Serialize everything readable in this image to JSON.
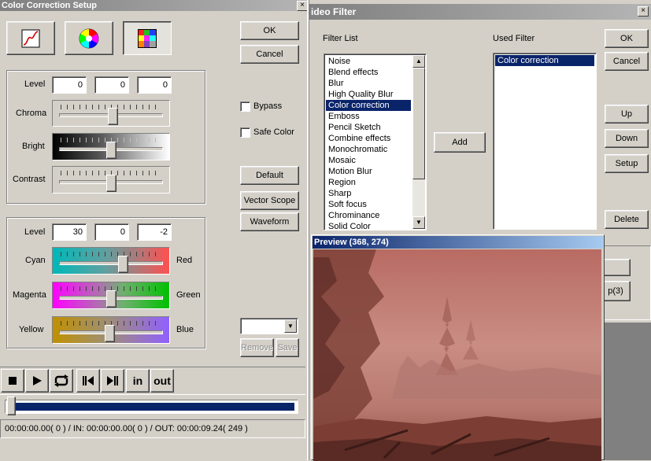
{
  "ccs": {
    "title": "Color Correction Setup",
    "close_glyph": "×",
    "ok_label": "OK",
    "cancel_label": "Cancel",
    "tool_icons": [
      "curve-icon",
      "color-wheel-icon",
      "color-grid-icon"
    ],
    "group1": {
      "level_label": "Level",
      "level_values": [
        "0",
        "0",
        "0"
      ],
      "chroma_label": "Chroma",
      "bright_label": "Bright",
      "contrast_label": "Contrast"
    },
    "bypass_label": "Bypass",
    "safe_color_label": "Safe Color",
    "default_label": "Default",
    "vector_scope_label": "Vector Scope",
    "waveform_label": "Waveform",
    "group2": {
      "level_label": "Level",
      "level_values": [
        "30",
        "0",
        "-2"
      ],
      "rows": [
        {
          "left": "Cyan",
          "right": "Red"
        },
        {
          "left": "Magenta",
          "right": "Green"
        },
        {
          "left": "Yellow",
          "right": "Blue"
        }
      ]
    },
    "remove_label": "Remove",
    "save_label": "Save",
    "transport": {
      "in_label": "in",
      "out_label": "out"
    },
    "status_text": "00:00:00.00( 0 ) / IN: 00:00:00.00( 0 ) / OUT: 00:00:09.24( 249 )"
  },
  "video_filter": {
    "title": "Video Filter",
    "title_visible": "ideo Filter",
    "filter_list_label": "Filter List",
    "used_filter_label": "Used Filter",
    "filters": [
      "Noise",
      "Blend effects",
      "Blur",
      "High Quality Blur",
      "Color correction",
      "Emboss",
      "Pencil Sketch",
      "Combine effects",
      "Monochromatic",
      "Mosaic",
      "Motion Blur",
      "Region",
      "Sharp",
      "Soft focus",
      "Chrominance",
      "Solid Color"
    ],
    "selected_filter": "Color correction",
    "used_filters": [
      "Color correction"
    ],
    "add_label": "Add",
    "ok_label": "OK",
    "cancel_label": "Cancel",
    "up_label": "Up",
    "down_label": "Down",
    "setup_label": "Setup",
    "delete_label": "Delete",
    "partial_button_label": "p(3)"
  },
  "preview": {
    "title": "Preview (368, 274)"
  },
  "colors": {
    "active_title": "#0a246a",
    "inactive_title": "#808080",
    "selection": "#0a246a",
    "progress_fill": "#0a246a"
  }
}
